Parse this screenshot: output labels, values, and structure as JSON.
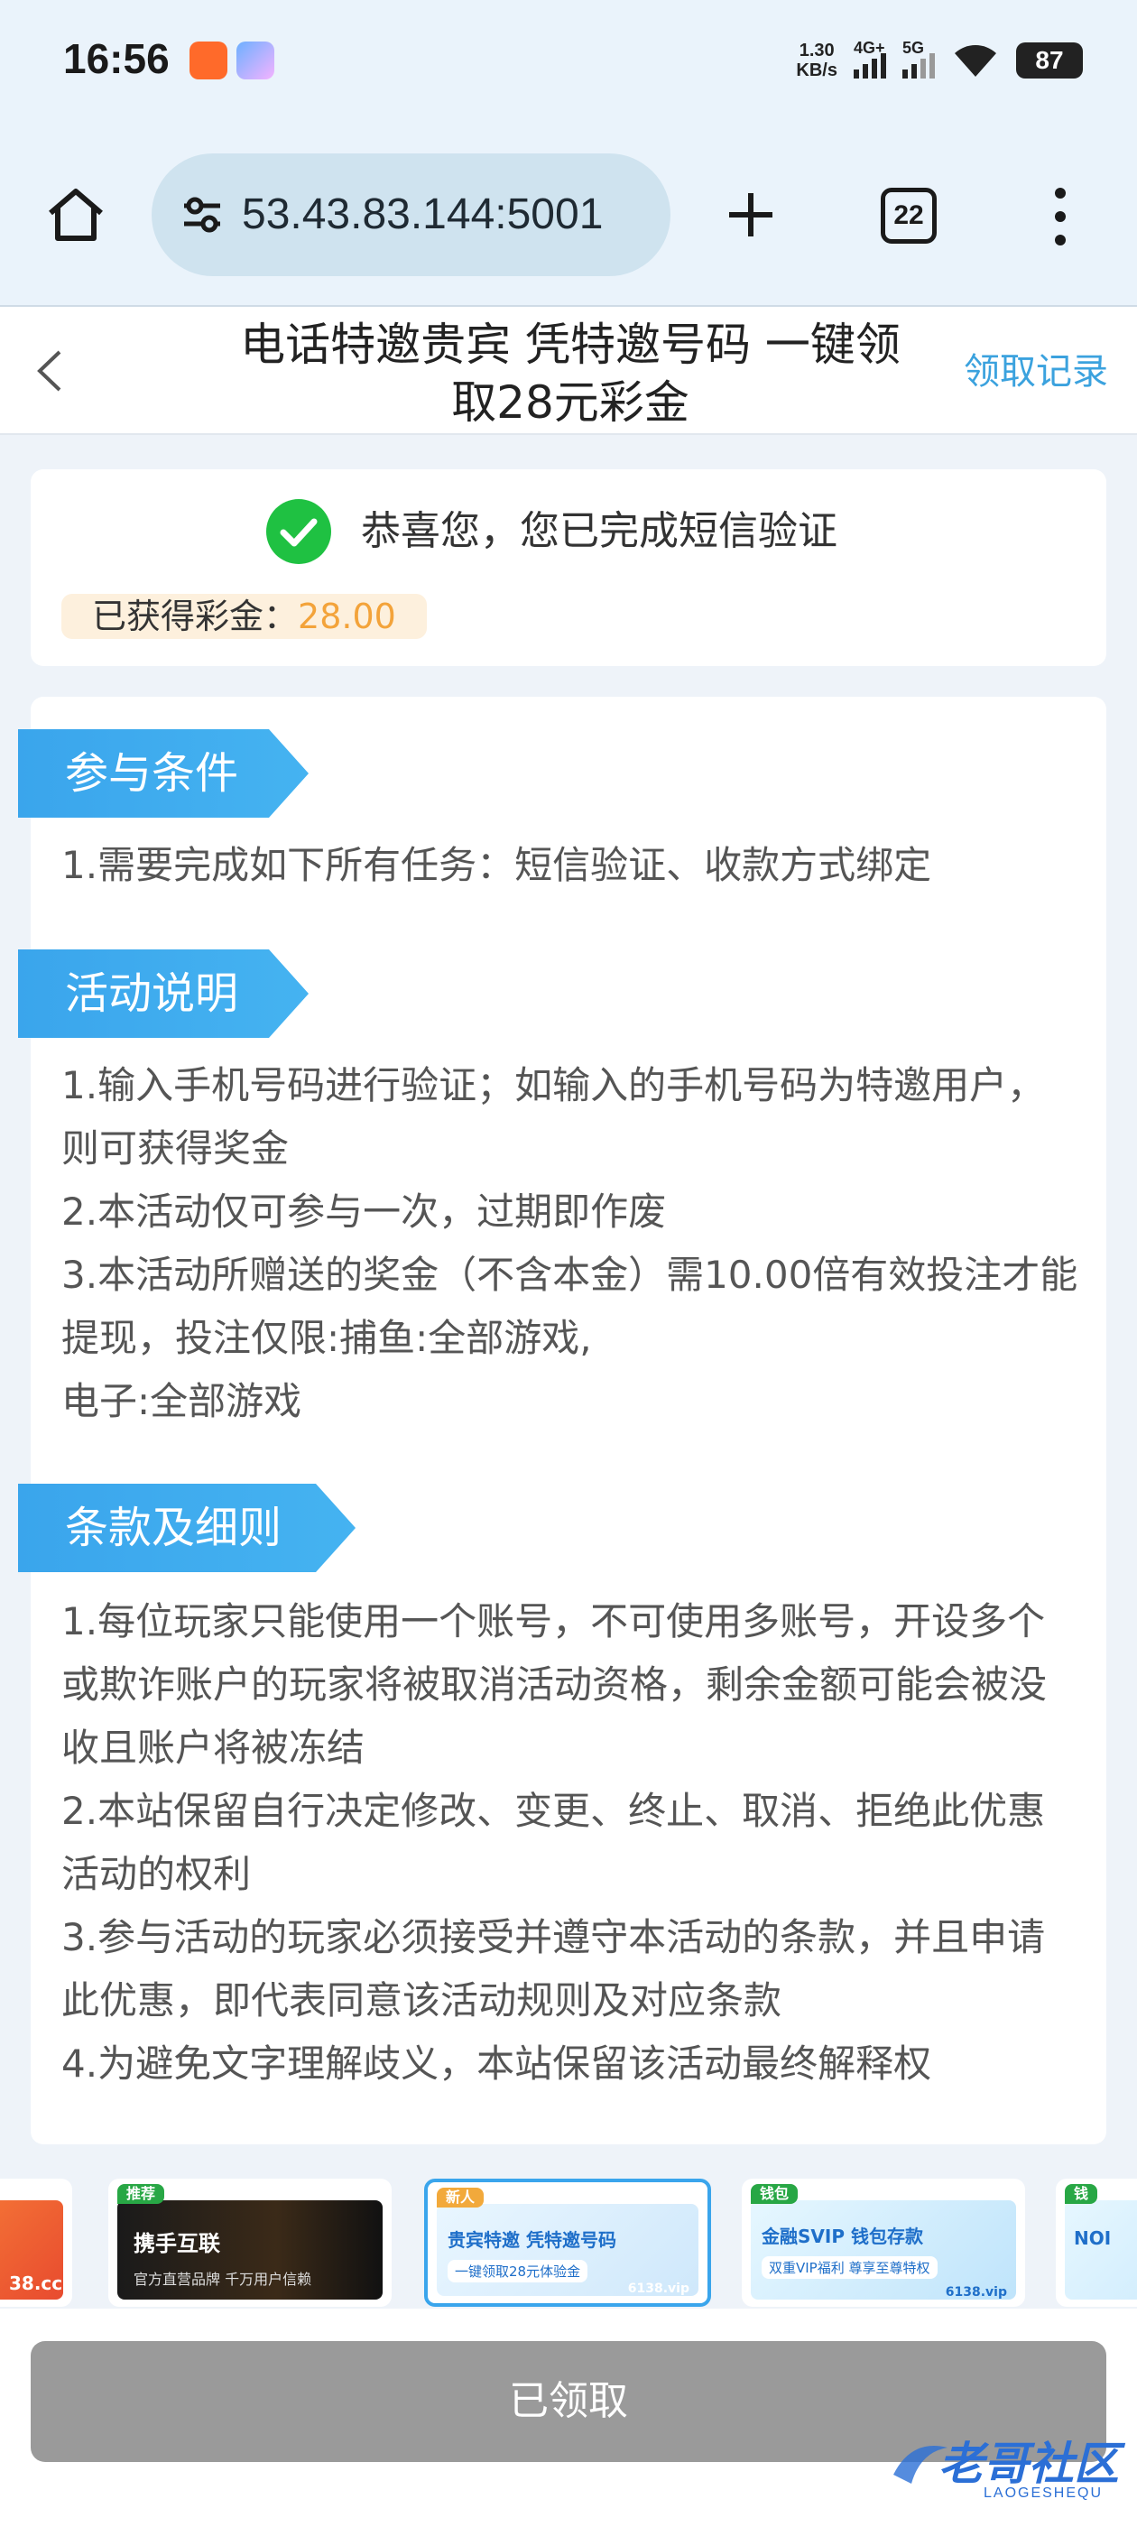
{
  "status_bar": {
    "time": "16:56",
    "net_speed_value": "1.30",
    "net_speed_unit": "KB/s",
    "signal_1_label": "4G+",
    "signal_2_label": "5G",
    "battery": "87"
  },
  "browser": {
    "url": "53.43.83.144:5001",
    "tab_count": "22"
  },
  "header": {
    "title": "电话特邀贵宾 凭特邀号码 一键领取28元彩金",
    "record_link": "领取记录"
  },
  "success": {
    "message": "恭喜您，您已完成短信验证",
    "bonus_label": "已获得彩金：",
    "bonus_amount": "28.00"
  },
  "sections": {
    "conditions": {
      "title": "参与条件",
      "lines": [
        "1.需要完成如下所有任务：短信验证、收款方式绑定"
      ]
    },
    "description": {
      "title": "活动说明",
      "lines": [
        "1.输入手机号码进行验证；如输入的手机号码为特邀用户，则可获得奖金",
        "2.本活动仅可参与一次，过期即作废",
        "3.本活动所赠送的奖金（不含本金）需10.00倍有效投注才能提现，投注仅限:捕鱼:全部游戏,",
        "电子:全部游戏"
      ]
    },
    "terms": {
      "title": "条款及细则",
      "lines": [
        "1.每位玩家只能使用一个账号，不可使用多账号，开设多个或欺诈账户的玩家将被取消活动资格，剩余金额可能会被没收且账户将被冻结",
        "2.本站保留自行决定修改、变更、终止、取消、拒绝此优惠活动的权利",
        "3.参与活动的玩家必须接受并遵守本活动的条款，并且申请此优惠，即代表同意该活动规则及对应条款",
        "4.为避免文字理解歧义，本站保留该活动最终解释权"
      ]
    }
  },
  "banners": [
    {
      "tag": "",
      "caption": "38.cc"
    },
    {
      "tag": "推荐",
      "caption": "携手互联",
      "sub": "官方直营品牌 千万用户信赖"
    },
    {
      "tag": "新人",
      "caption": "贵宾特邀 凭特邀号码",
      "sub": "一键领取28元体验金",
      "url": "6138.vip"
    },
    {
      "tag": "钱包",
      "caption": "金融SVIP 钱包存款",
      "sub": "双重VIP福利 尊享至尊特权",
      "url": "6138.vip"
    },
    {
      "tag": "钱",
      "caption": "NOI"
    }
  ],
  "bottom": {
    "claim_button": "已领取",
    "watermark": "老哥社区",
    "watermark_sub": "LAOGESHEQU"
  },
  "colors": {
    "accent": "#3aa5ec",
    "success": "#1fc142",
    "bonus": "#f3a33a",
    "disabled_button": "#9a9a9a"
  }
}
